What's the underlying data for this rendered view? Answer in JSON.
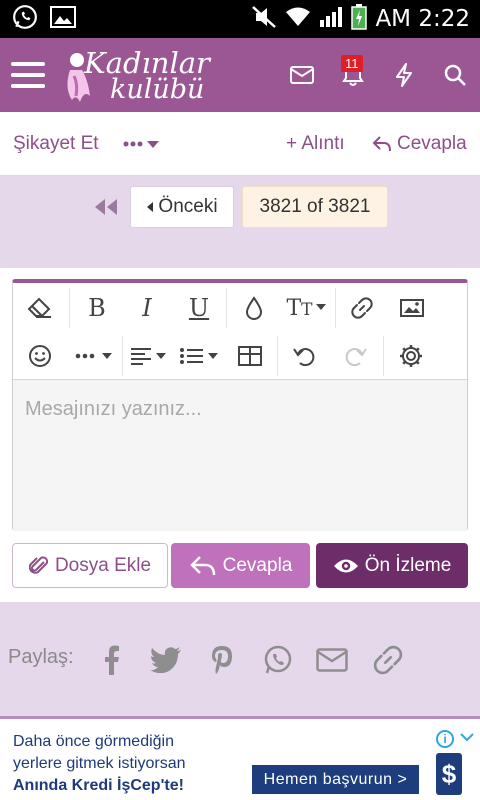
{
  "status_bar": {
    "time": "AM 2:22"
  },
  "header": {
    "logo_line1": "Kadınlar",
    "logo_line2": "kulübü",
    "notification_count": "11"
  },
  "actions": {
    "report_label": "Şikayet Et",
    "quote_label": "+ Alıntı",
    "reply_label": "Cevapla"
  },
  "pagination": {
    "prev_label": "Önceki",
    "current_label": "3821 of 3821"
  },
  "editor": {
    "placeholder": "Mesajınızı yazınız..."
  },
  "buttons": {
    "attach_label": "Dosya Ekle",
    "reply_label": "Cevapla",
    "preview_label": "Ön İzleme"
  },
  "share": {
    "label": "Paylaş:"
  },
  "ad": {
    "line1": "Daha önce görmediğin",
    "line2": "yerlere gitmek istiyorsan",
    "line3": "Anında Kredi İşCep'te!",
    "cta": "Hemen başvurun >"
  },
  "colors": {
    "brand": "#9b5794",
    "brand_dark": "#6d2d68",
    "brand_light": "#bf72bb",
    "page_bg": "#e5d8ea"
  }
}
